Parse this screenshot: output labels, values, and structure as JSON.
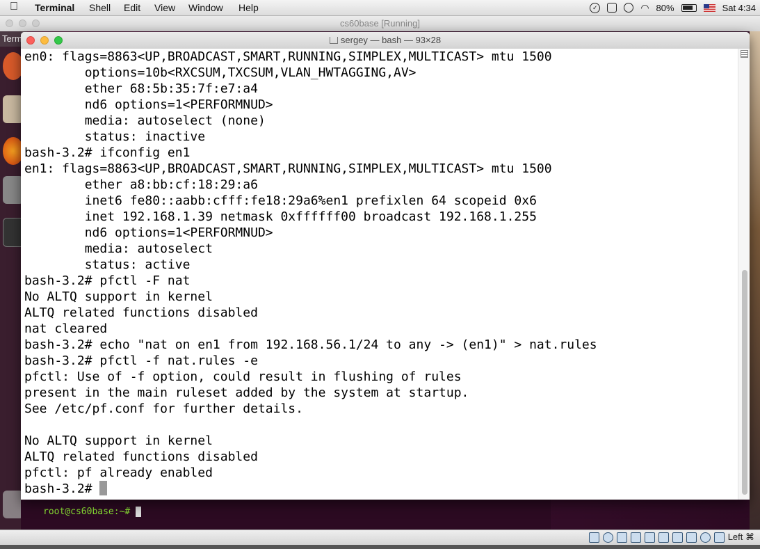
{
  "menubar": {
    "app": "Terminal",
    "items": [
      "Shell",
      "Edit",
      "View",
      "Window",
      "Help"
    ],
    "battery": "80%",
    "clock": "Sat 4:34"
  },
  "vbox": {
    "title": "cs60base [Running]",
    "launcher_tab": "Term",
    "guest_prompt": "root@cs60base:~#",
    "status_host_key": "Left ⌘"
  },
  "terminal": {
    "title": "sergey — bash — 93×28",
    "lines": [
      "en0: flags=8863<UP,BROADCAST,SMART,RUNNING,SIMPLEX,MULTICAST> mtu 1500",
      "        options=10b<RXCSUM,TXCSUM,VLAN_HWTAGGING,AV>",
      "        ether 68:5b:35:7f:e7:a4",
      "        nd6 options=1<PERFORMNUD>",
      "        media: autoselect (none)",
      "        status: inactive",
      "bash-3.2# ifconfig en1",
      "en1: flags=8863<UP,BROADCAST,SMART,RUNNING,SIMPLEX,MULTICAST> mtu 1500",
      "        ether a8:bb:cf:18:29:a6",
      "        inet6 fe80::aabb:cfff:fe18:29a6%en1 prefixlen 64 scopeid 0x6",
      "        inet 192.168.1.39 netmask 0xffffff00 broadcast 192.168.1.255",
      "        nd6 options=1<PERFORMNUD>",
      "        media: autoselect",
      "        status: active",
      "bash-3.2# pfctl -F nat",
      "No ALTQ support in kernel",
      "ALTQ related functions disabled",
      "nat cleared",
      "bash-3.2# echo \"nat on en1 from 192.168.56.1/24 to any -> (en1)\" > nat.rules",
      "bash-3.2# pfctl -f nat.rules -e",
      "pfctl: Use of -f option, could result in flushing of rules",
      "present in the main ruleset added by the system at startup.",
      "See /etc/pf.conf for further details.",
      "",
      "No ALTQ support in kernel",
      "ALTQ related functions disabled",
      "pfctl: pf already enabled",
      "bash-3.2# "
    ]
  }
}
